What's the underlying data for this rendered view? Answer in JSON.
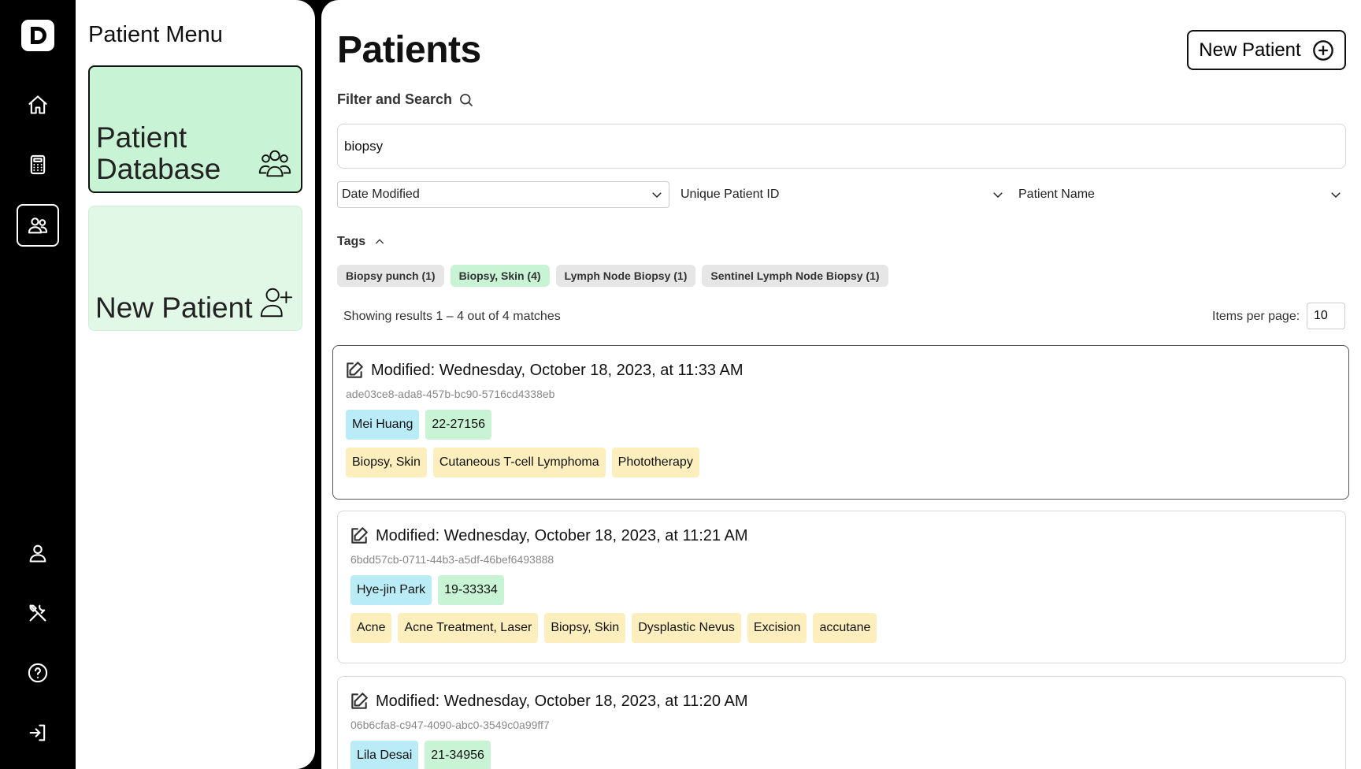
{
  "nav": {
    "logo_letter": "D",
    "items": [
      "home-icon",
      "calculator-icon",
      "users-icon",
      "user-icon",
      "tools-icon",
      "help-icon",
      "logout-icon"
    ],
    "active": "users-icon"
  },
  "menu": {
    "title": "Patient Menu",
    "cards": [
      {
        "label": "Patient Database",
        "icon": "users-group-icon"
      },
      {
        "label": "New Patient",
        "icon": "user-plus-icon"
      }
    ]
  },
  "page": {
    "title": "Patients",
    "new_button": "New Patient"
  },
  "filter": {
    "label": "Filter and Search",
    "search_value": "biopsy",
    "selects": [
      "Date Modified",
      "Unique Patient ID",
      "Patient Name"
    ],
    "tags_label": "Tags",
    "tags": [
      "Biopsy punch (1)",
      "Biopsy, Skin (4)",
      "Lymph Node Biopsy (1)",
      "Sentinel Lymph Node Biopsy (1)"
    ],
    "selected_tag": "Biopsy, Skin (4)"
  },
  "results": {
    "summary": "Showing results 1 – 4 out of 4 matches",
    "items_per_page_label": "Items per page:",
    "items_per_page": "10"
  },
  "records": [
    {
      "modified": "Modified: Wednesday, October 18, 2023, at 11:33 AM",
      "uuid": "ade03ce8-ada8-457b-bc90-5716cd4338eb",
      "name": "Mei Huang",
      "pid": "22-27156",
      "tags": [
        "Biopsy, Skin",
        "Cutaneous T-cell Lymphoma",
        "Phototherapy"
      ]
    },
    {
      "modified": "Modified: Wednesday, October 18, 2023, at 11:21 AM",
      "uuid": "6bdd57cb-0711-44b3-a5df-46bef6493888",
      "name": "Hye-jin Park",
      "pid": "19-33334",
      "tags": [
        "Acne",
        "Acne Treatment, Laser",
        "Biopsy, Skin",
        "Dysplastic Nevus",
        "Excision",
        "accutane"
      ]
    },
    {
      "modified": "Modified: Wednesday, October 18, 2023, at 11:20 AM",
      "uuid": "06b6cfa8-c947-4090-abc0-3549c0a99ff7",
      "name": "Lila Desai",
      "pid": "21-34956",
      "tags": []
    }
  ],
  "colors": {
    "accent_green": "#c8f3d5",
    "name_blue": "#b9ecf6",
    "tag_yellow": "#fcefbd"
  }
}
